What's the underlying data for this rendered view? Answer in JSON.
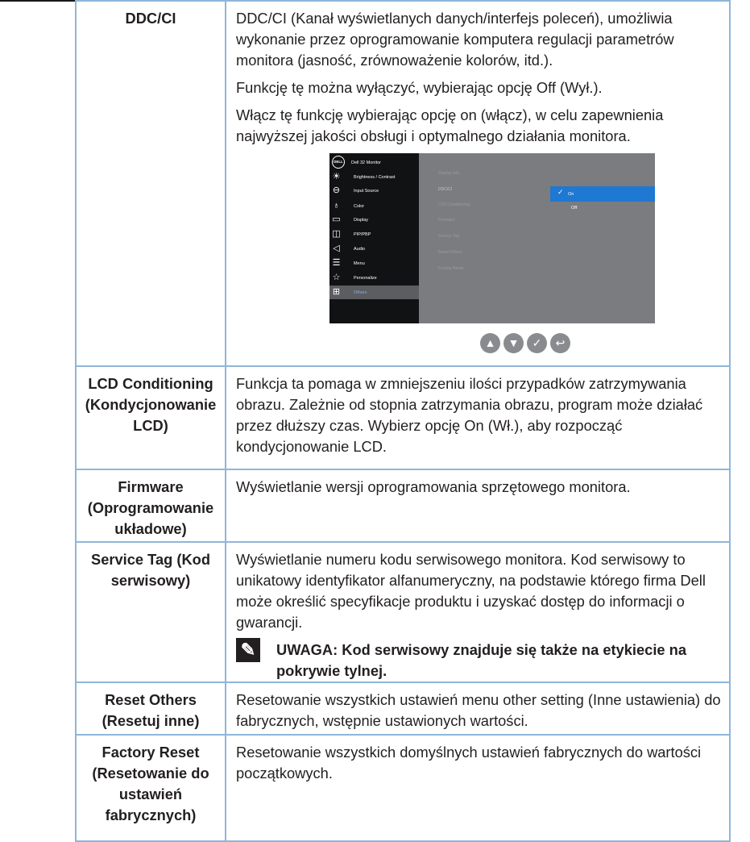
{
  "rows": {
    "ddc": {
      "key": "DDC/CI",
      "p1": "DDC/CI (Kanał wyświetlanych danych/interfejs poleceń), umożliwia wykonanie przez oprogramowanie komputera regulacji parametrów monitora (jasność, zrównoważenie kolorów, itd.).",
      "p2": "Funkcję tę można wyłączyć, wybierając opcję Off (Wył.).",
      "p3": "Włącz tę funkcję wybierając opcję on (włącz), w celu zapewnienia najwyższej jakości obsługi i optymalnego działania monitora."
    },
    "lcd": {
      "key": "LCD Conditioning (Kondycjonowanie LCD)",
      "text": "Funkcja ta pomaga w zmniejszeniu ilości przypadków zatrzymywania obrazu. Zależnie od stopnia zatrzymania obrazu, program może działać przez dłuższy czas. Wybierz opcję On (Wł.), aby rozpocząć kondycjonowanie LCD."
    },
    "firmware": {
      "key": "Firmware (Oprogramowanie układowe)",
      "text": "Wyświetlanie wersji oprogramowania sprzętowego monitora."
    },
    "servicetag": {
      "key": "Service Tag (Kod serwisowy)",
      "text": "Wyświetlanie numeru kodu serwisowego monitora. Kod serwisowy to unikatowy identyfikator alfanumeryczny, na podstawie którego firma Dell może określić specyfikacje produktu i uzyskać dostęp do informacji o gwarancji.",
      "note": "UWAGA: Kod serwisowy znajduje się także na etykiecie na pokrywie tylnej."
    },
    "resetothers": {
      "key": "Reset Others (Resetuj inne)",
      "text": "Resetowanie wszystkich ustawień menu other setting (Inne ustawienia) do fabrycznych, wstępnie ustawionych wartości."
    },
    "factoryreset": {
      "key": "Factory Reset (Resetowanie do ustawień fabrycznych)",
      "text": "Resetowanie wszystkich domyślnych ustawień fabrycznych do wartości początkowych."
    }
  },
  "osd": {
    "logo": "DELL",
    "title": "Dell 32 Monitor",
    "menu": [
      {
        "label": "Brightness / Contrast",
        "icon": "brightness-icon"
      },
      {
        "label": "Input Source",
        "icon": "input-source-icon"
      },
      {
        "label": "Color",
        "icon": "color-icon"
      },
      {
        "label": "Display",
        "icon": "display-icon"
      },
      {
        "label": "PIP/PBP",
        "icon": "pip-icon"
      },
      {
        "label": "Audio",
        "icon": "audio-icon"
      },
      {
        "label": "Menu",
        "icon": "menu-icon"
      },
      {
        "label": "Personalize",
        "icon": "star-icon"
      },
      {
        "label": "Others",
        "icon": "others-icon"
      }
    ],
    "submenu": [
      "Display Info",
      "DDC/CI",
      "LCD Conditioning",
      "Firmware",
      "Service Tag",
      "Reset Others",
      "Factory Reset"
    ],
    "options": {
      "on": "On",
      "off": "Off"
    },
    "accent": "#1f78d1"
  },
  "nav_icons": [
    "up-icon",
    "down-icon",
    "check-icon",
    "back-icon"
  ]
}
